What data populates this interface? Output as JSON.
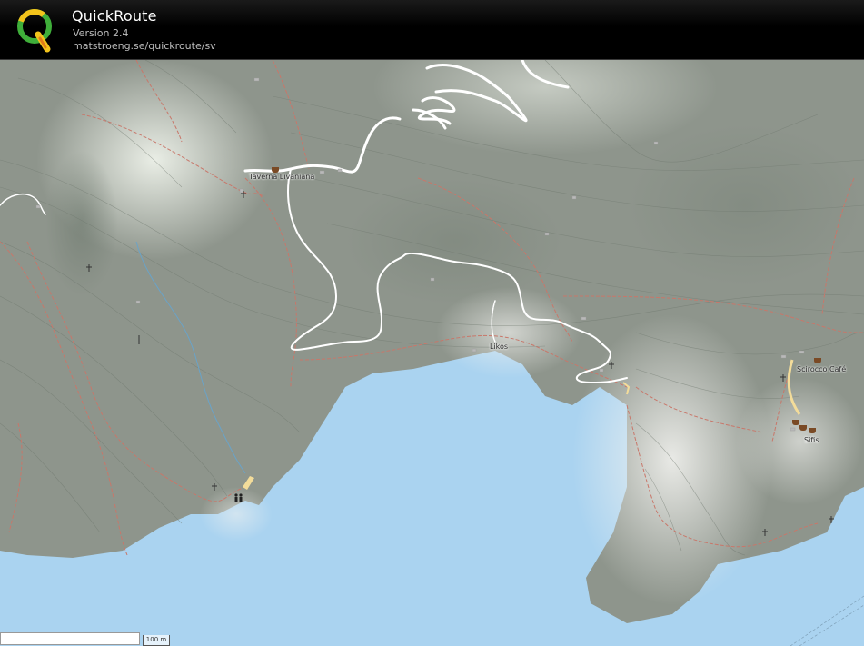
{
  "header": {
    "title": "QuickRoute",
    "version": "Version 2.4",
    "url": "matstroeng.se/quickroute/sv",
    "logo_letter": "Q"
  },
  "map": {
    "labels": {
      "taverna": "Taverna Livaniana",
      "likos": "Likos",
      "scirocco": "Scirocco Café",
      "sifis": "Sifis"
    },
    "scale": "100 m",
    "icons": [
      "church-icon",
      "cafe-icon",
      "toilets-icon"
    ],
    "colors": {
      "sea": "#aad3f0",
      "land": "#8d948b",
      "trail": "#c8776a",
      "route": "#ffffff"
    }
  }
}
